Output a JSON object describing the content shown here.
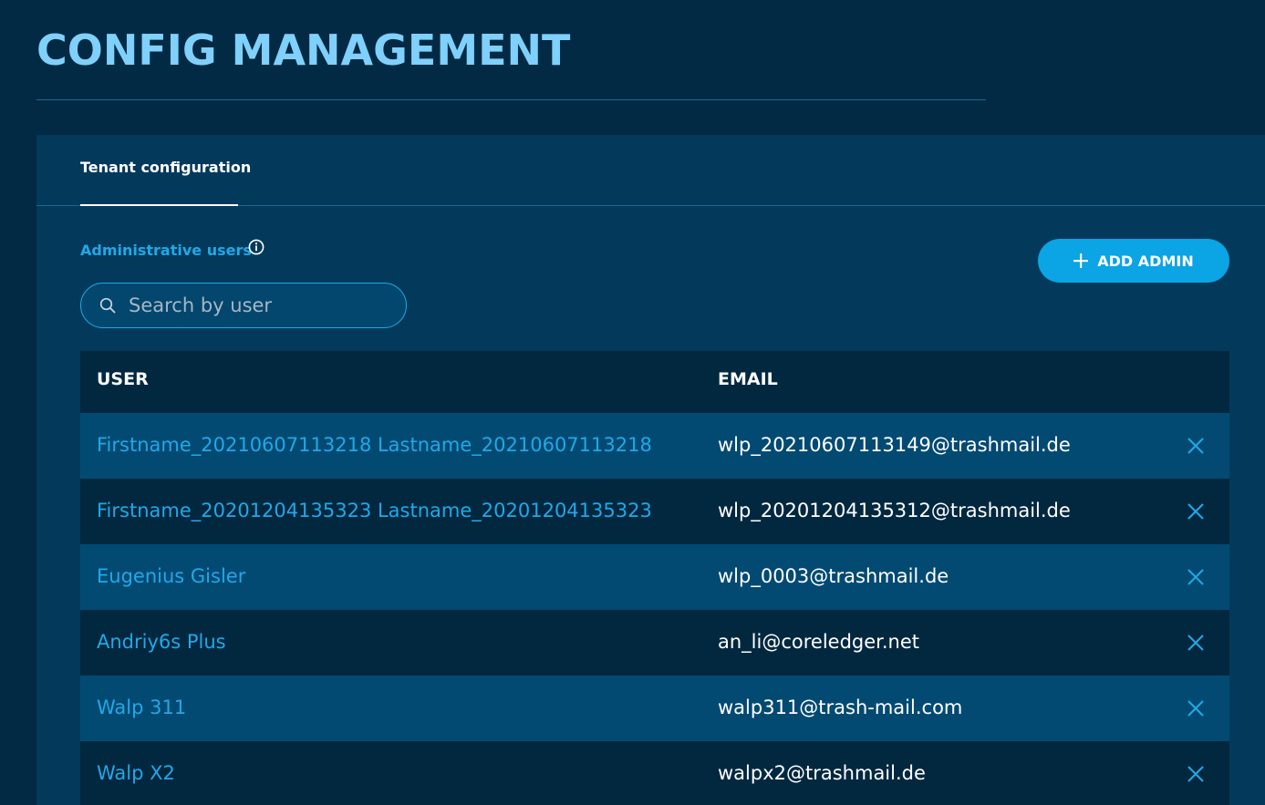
{
  "page": {
    "title": "CONFIG MANAGEMENT"
  },
  "tabs": [
    {
      "label": "Tenant configuration",
      "active": true
    }
  ],
  "section": {
    "label": "Administrative users",
    "info_icon": "info-icon",
    "add_button": {
      "icon": "plus-icon",
      "label": "ADD ADMIN"
    }
  },
  "search": {
    "placeholder": "Search by user",
    "value": "",
    "icon": "search-icon"
  },
  "table": {
    "headers": {
      "user": "USER",
      "email": "EMAIL"
    },
    "remove_icon": "close-icon",
    "rows": [
      {
        "user": "Firstname_20210607113218 Lastname_20210607113218",
        "email": "wlp_20210607113149@trashmail.de"
      },
      {
        "user": "Firstname_20201204135323 Lastname_20201204135323",
        "email": "wlp_20201204135312@trashmail.de"
      },
      {
        "user": "Eugenius Gisler",
        "email": "wlp_0003@trashmail.de"
      },
      {
        "user": "Andriy6s Plus",
        "email": "an_li@coreledger.net"
      },
      {
        "user": "Walp 311",
        "email": "walp311@trash-mail.com"
      },
      {
        "user": "Walp X2",
        "email": "walpx2@trashmail.de"
      }
    ]
  },
  "colors": {
    "background": "#032a44",
    "panel": "#033a5c",
    "title": "#7fd0fb",
    "accent": "#0ba4e4",
    "link": "#22a8e6",
    "row_alt": "#034a73",
    "row_dark": "#022840"
  }
}
